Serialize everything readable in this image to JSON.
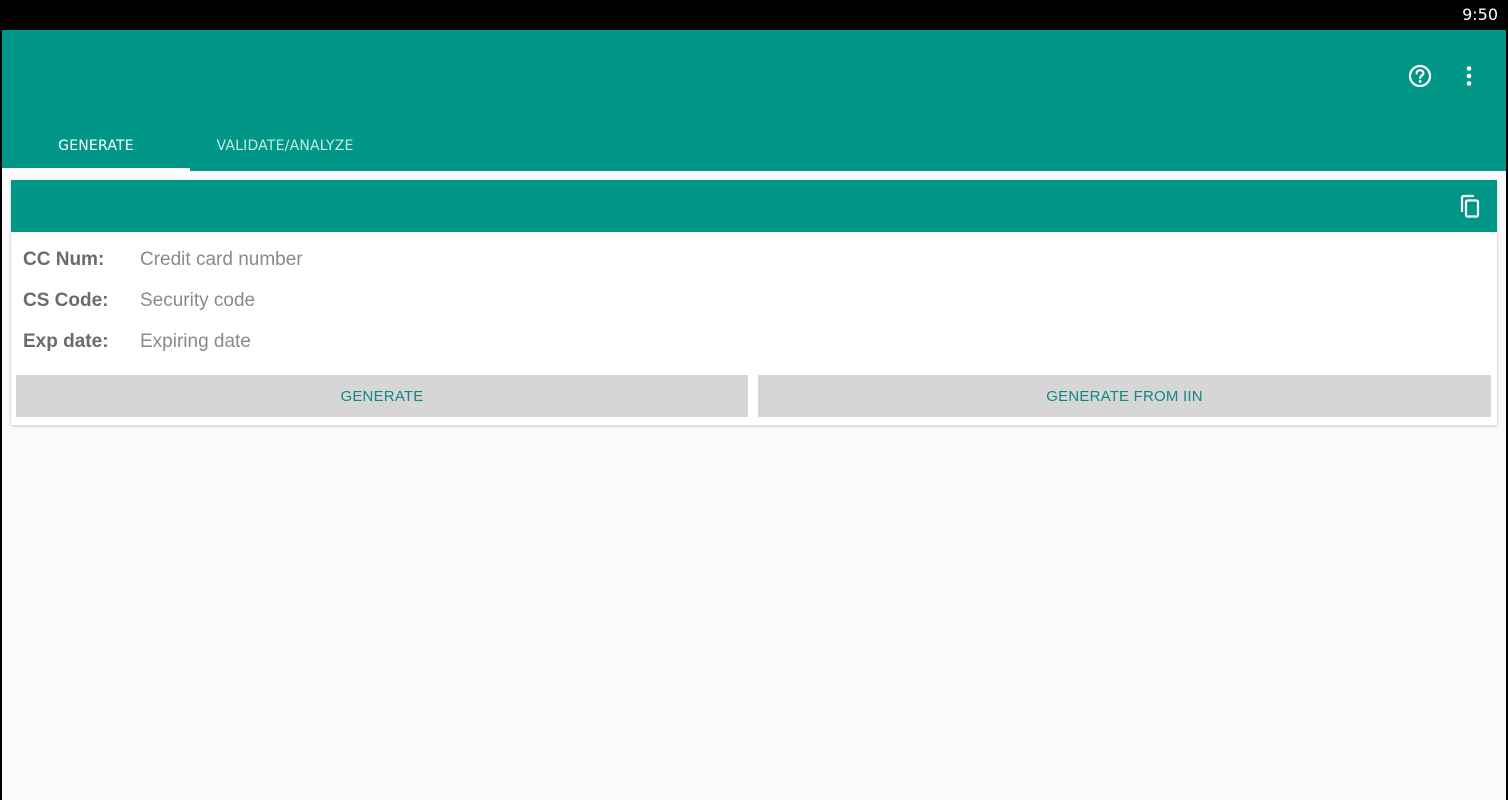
{
  "status_bar": {
    "time": "9:50"
  },
  "app_bar": {
    "icons": {
      "help": "help-circle-icon",
      "overflow": "more-vert-icon"
    }
  },
  "tabs": [
    {
      "label": "GENERATE",
      "active": true
    },
    {
      "label": "VALIDATE/ANALYZE",
      "active": false
    }
  ],
  "card": {
    "header_icon": "copy-icon",
    "fields": [
      {
        "label": "CC Num:",
        "value": "Credit card number"
      },
      {
        "label": "CS Code:",
        "value": "Security code"
      },
      {
        "label": "Exp date:",
        "value": "Expiring date"
      }
    ],
    "buttons": {
      "generate": "GENERATE",
      "generate_from_iin": "GENERATE FROM IIN"
    }
  },
  "colors": {
    "primary": "#009688",
    "button_bg": "#d6d6d6",
    "button_text": "#12897c",
    "background": "#fafafa"
  }
}
